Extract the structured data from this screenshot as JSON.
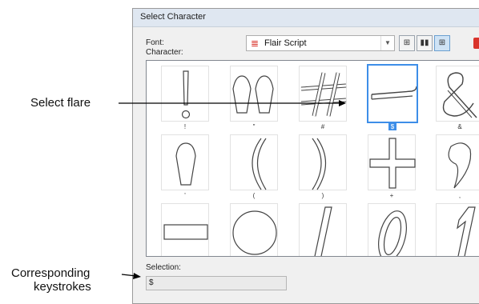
{
  "dialog": {
    "title": "Select Character",
    "font_label": "Font:",
    "font_value": "Flair Script",
    "character_label": "Character:",
    "selection_label": "Selection:",
    "selection_value": "$"
  },
  "characters": [
    {
      "glyph": "!",
      "caption": "!"
    },
    {
      "glyph": "\"",
      "caption": "\""
    },
    {
      "glyph": "#",
      "caption": "#"
    },
    {
      "glyph": "$",
      "caption": "$",
      "selected": true
    },
    {
      "glyph": "&",
      "caption": "&"
    },
    {
      "glyph": "'",
      "caption": "'"
    },
    {
      "glyph": "(",
      "caption": "("
    },
    {
      "glyph": ")",
      "caption": ")"
    },
    {
      "glyph": "+",
      "caption": "+"
    },
    {
      "glyph": ",",
      "caption": ","
    },
    {
      "glyph": "-",
      "caption": ""
    },
    {
      "glyph": "●",
      "caption": ""
    },
    {
      "glyph": "/",
      "caption": ""
    },
    {
      "glyph": "0",
      "caption": ""
    },
    {
      "glyph": "1",
      "caption": ""
    }
  ],
  "annotations": {
    "select_flare": "Select flare",
    "corresponding_line1": "Corresponding",
    "corresponding_line2": "keystrokes"
  },
  "colors": {
    "accent": "#3d8ee8",
    "font_icon": "#d9332b"
  }
}
